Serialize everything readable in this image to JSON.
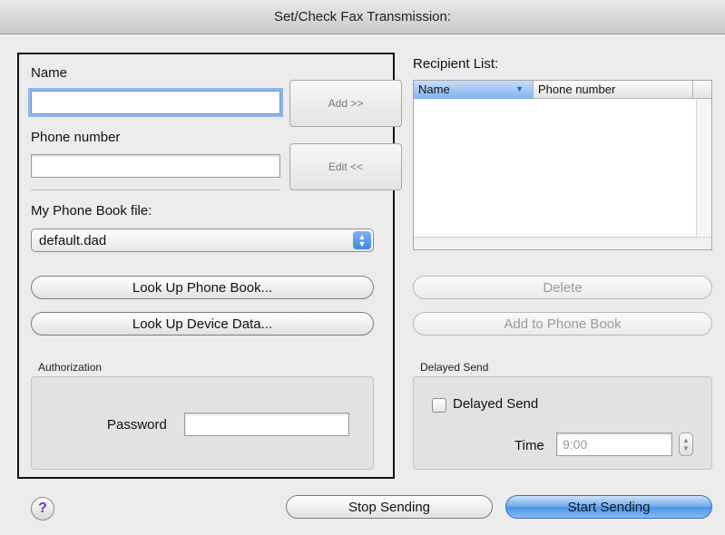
{
  "window": {
    "title": "Set/Check Fax Transmission:"
  },
  "left": {
    "name_label": "Name",
    "name_value": "",
    "phone_label": "Phone number",
    "phone_value": "",
    "add_button": "Add >>",
    "edit_button": "Edit <<",
    "phonebook_label": "My Phone Book file:",
    "phonebook_selected": "default.dad",
    "lookup_phonebook_button": "Look Up Phone Book...",
    "lookup_device_button": "Look Up Device Data...",
    "authorization_title": "Authorization",
    "password_label": "Password",
    "password_value": ""
  },
  "right": {
    "recipient_list_label": "Recipient List:",
    "columns": [
      "Name",
      "Phone number"
    ],
    "sort_indicator": "▼",
    "rows": [],
    "delete_button": "Delete",
    "add_to_phonebook_button": "Add to Phone Book",
    "delayed_send_title": "Delayed Send",
    "delayed_send_checkbox_label": "Delayed Send",
    "delayed_send_checked": false,
    "time_label": "Time",
    "time_value": "9:00"
  },
  "footer": {
    "help_glyph": "?",
    "stop_button": "Stop Sending",
    "start_button": "Start Sending"
  },
  "icons": {
    "popup_arrows": "updown-arrows-icon",
    "stepper": "stepper-arrows-icon",
    "help": "help-icon"
  },
  "colors": {
    "focus_ring": "#8fb4ea",
    "primary_button": "#5b9ee8",
    "help_glyph": "#7a2fb3"
  }
}
